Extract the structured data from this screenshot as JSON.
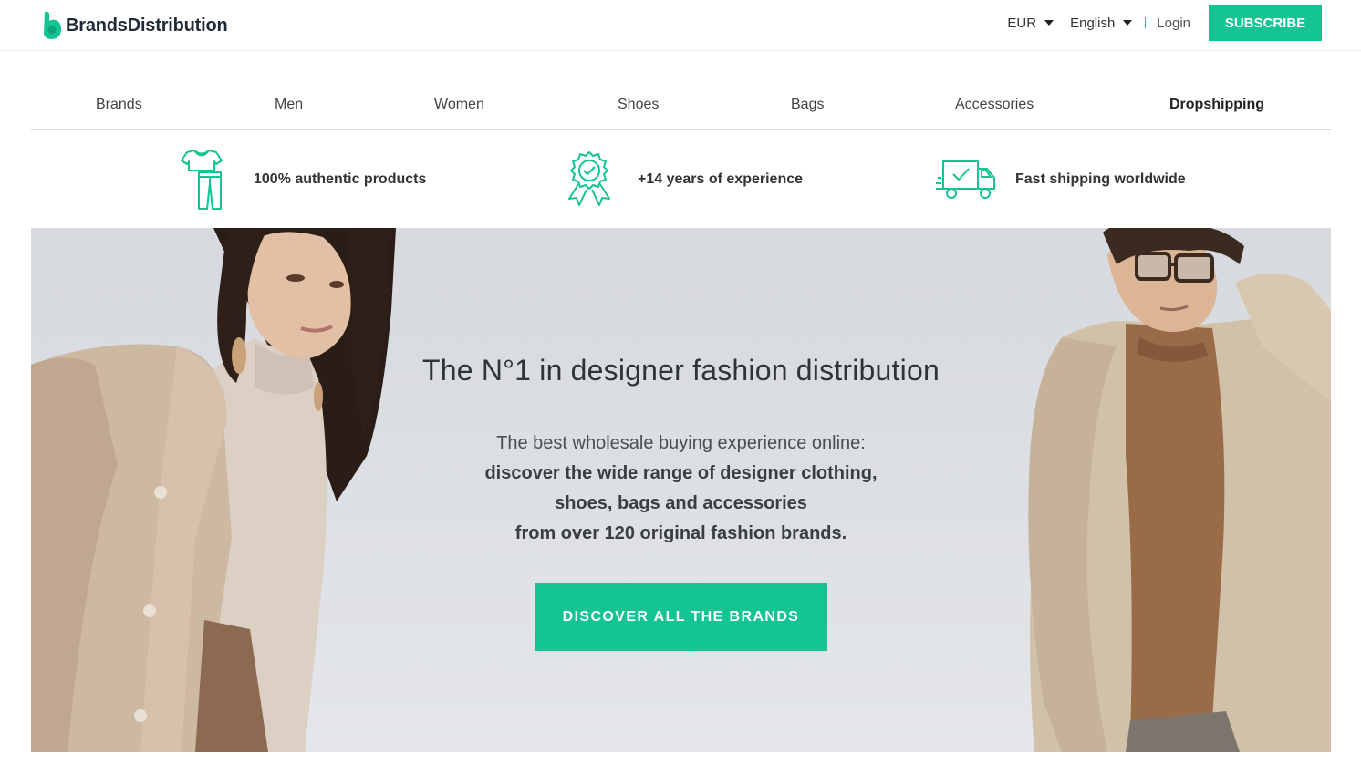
{
  "brand": {
    "name": "BrandsDistribution",
    "accent_color": "#14c492"
  },
  "header": {
    "currency": "EUR",
    "language": "English",
    "login_label": "Login",
    "subscribe_label": "SUBSCRIBE"
  },
  "nav": {
    "items": [
      {
        "label": "Brands"
      },
      {
        "label": "Men"
      },
      {
        "label": "Women"
      },
      {
        "label": "Shoes"
      },
      {
        "label": "Bags"
      },
      {
        "label": "Accessories"
      },
      {
        "label": "Dropshipping"
      }
    ]
  },
  "features": [
    {
      "icon": "clothing-icon",
      "text": "100% authentic products"
    },
    {
      "icon": "award-badge-icon",
      "text": "+14 years of experience"
    },
    {
      "icon": "delivery-truck-icon",
      "text": "Fast shipping worldwide"
    }
  ],
  "hero": {
    "title": "The N°1 in designer fashion distribution",
    "subtitle_line1": "The best wholesale buying experience online:",
    "subtitle_line2": "discover the wide range of designer clothing,",
    "subtitle_line3": "shoes, bags and accessories",
    "subtitle_line4": "from over 120 original fashion brands.",
    "cta_label": "DISCOVER ALL THE BRANDS"
  }
}
